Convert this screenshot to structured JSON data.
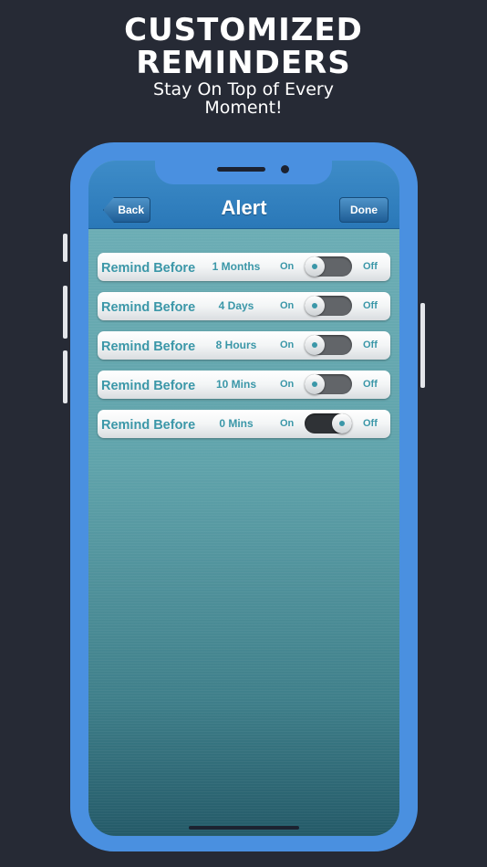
{
  "promo": {
    "title_line1": "CUSTOMIZED",
    "title_line2": "REMINDERS",
    "subtitle_line1": "Stay On Top of Every",
    "subtitle_line2": "Moment!"
  },
  "navbar": {
    "title": "Alert",
    "back_label": "Back",
    "done_label": "Done"
  },
  "reminders": [
    {
      "label": "Remind Before",
      "value": "1 Months",
      "on_label": "On",
      "off_label": "Off",
      "enabled": false
    },
    {
      "label": "Remind Before",
      "value": "4 Days",
      "on_label": "On",
      "off_label": "Off",
      "enabled": false
    },
    {
      "label": "Remind Before",
      "value": "8 Hours",
      "on_label": "On",
      "off_label": "Off",
      "enabled": false
    },
    {
      "label": "Remind Before",
      "value": "10 Mins",
      "on_label": "On",
      "off_label": "Off",
      "enabled": false
    },
    {
      "label": "Remind Before",
      "value": "0 Mins",
      "on_label": "On",
      "off_label": "Off",
      "enabled": true
    }
  ],
  "colors": {
    "background": "#262a35",
    "phone_frame": "#4a90e0",
    "navbar": "#2a78b8",
    "accent_text": "#3b97a8"
  }
}
